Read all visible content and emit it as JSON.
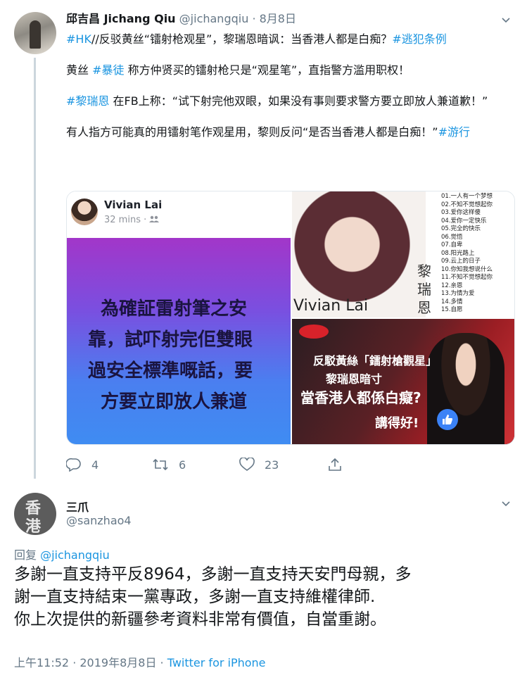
{
  "tweet1": {
    "display_name": "邱吉昌 Jichang Qiu",
    "handle": "@jichangqiu",
    "separator": "·",
    "date": "8月8日",
    "line1_tag_hk": "#HK",
    "line1_text": "//反驳黄丝“镭射枪观星”，黎瑞恩暗讽：当香港人都是白痴？",
    "line1_tag_law": "#逃犯条例",
    "p2_pre": "黄丝 ",
    "p2_tag": "#暴徒",
    "p2_post": " 称方仲贤买的镭射枪只是“观星笔”，直指警方滥用职权！",
    "p3_tag": "#黎瑞恩",
    "p3_text": " 在FB上称：“试下射完他双眼，如果没有事则要求警方要立即放人兼道歉！”",
    "p4_text": "有人指方可能真的用镭射笔作观星用，黎则反问“是否当香港人都是白痴！”",
    "p4_tag": "#游行",
    "media": {
      "fb_name": "Vivian Lai",
      "fb_time": "32 mins ·",
      "fb_lines": [
        "為確証雷射筆之安",
        "靠，試吓射完佢雙眼",
        "過安全標準嘅話，要",
        "方要立即放人兼道"
      ],
      "album_name": "Vivian Lai",
      "album_cn_name": [
        "黎",
        "瑞",
        "恩"
      ],
      "tracks": [
        "01.一人有一个梦想",
        "02.不知不觉想起你",
        "03.爱你这样傻",
        "04.爱你一定快乐",
        "05.完全的快乐",
        "06.觉悟",
        "07.自卑",
        "08.阳光路上",
        "09.云上的日子",
        "10.你知我想说什么",
        "11.不知不觉想起你",
        "12.亲恩",
        "13.为情为爱",
        "14.多情",
        "15.自愿"
      ],
      "news_line1": "反駁黃絲「鐳射槍觀星」",
      "news_line2": "黎瑞恩暗寸",
      "news_line3": "當香港人都係白癡?",
      "news_line4": "講得好!"
    },
    "actions": {
      "replies": "4",
      "retweets": "6",
      "likes": "23"
    }
  },
  "tweet2": {
    "display_name": "三爪",
    "handle": "@sanzhao4",
    "avatar_chars": [
      "香",
      "港"
    ],
    "reply_label": "回复 ",
    "reply_to": "@jichangqiu",
    "body_lines": [
      "多謝一直支持平反8964，多謝一直支持天安門母親，多",
      "謝一直支持結束一黨專政，多謝一直支持維權律師.",
      "你上次提供的新疆參考資料非常有價值，自當重謝。"
    ],
    "timestamp": "上午11:52 · 2019年8月8日 · ",
    "source": "Twitter for iPhone"
  },
  "colors": {
    "link": "#1b95e0",
    "muted": "#657786",
    "text": "#14171a"
  }
}
